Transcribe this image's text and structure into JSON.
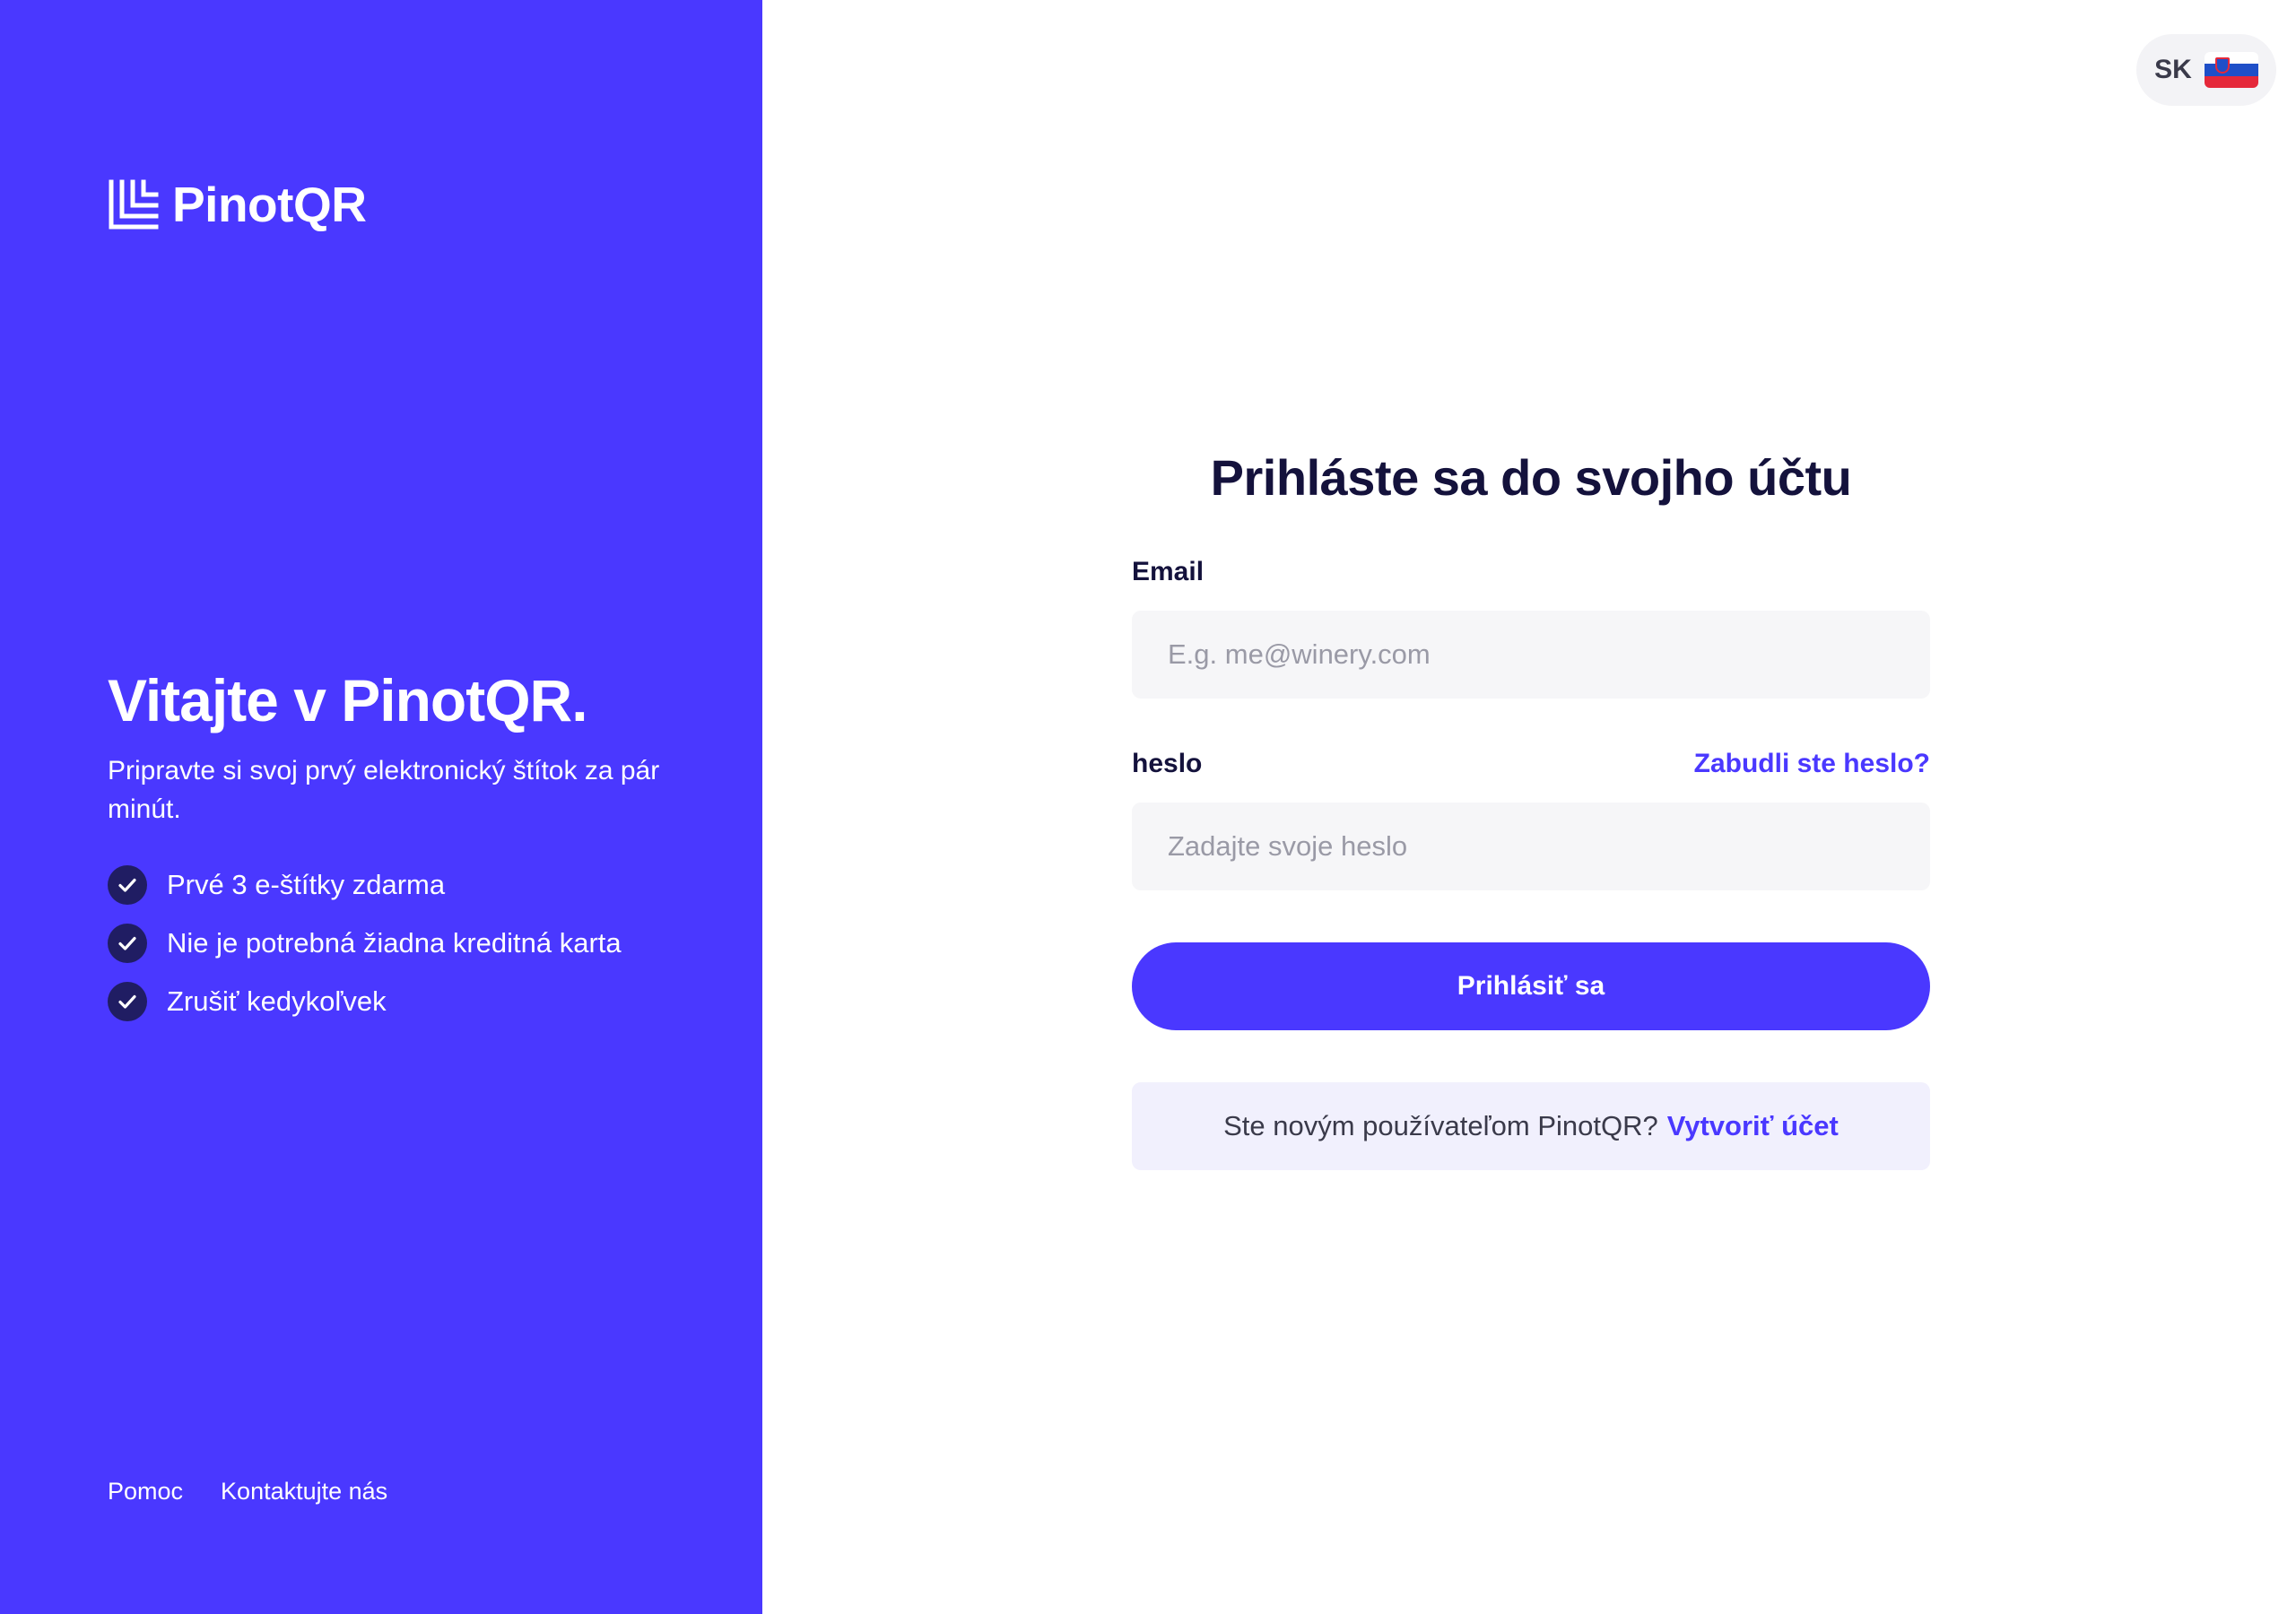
{
  "brand": {
    "name": "PinotQR",
    "accent_color": "#4a38ff",
    "dark_color": "#14123c"
  },
  "left_panel": {
    "welcome_title": "Vitajte v PinotQR.",
    "welcome_subtitle": "Pripravte si svoj prvý elektronický štítok za pár minút.",
    "features": [
      "Prvé 3 e-štítky zdarma",
      "Nie je potrebná žiadna kreditná karta",
      "Zrušiť kedykoľvek"
    ],
    "footer_links": [
      "Pomoc",
      "Kontaktujte nás"
    ]
  },
  "language_switcher": {
    "code": "SK",
    "flag_icon": "slovakia-flag-icon"
  },
  "login_form": {
    "title": "Prihláste sa do svojho účtu",
    "email_label": "Email",
    "email_placeholder": "E.g. me@winery.com",
    "email_value": "",
    "password_label": "heslo",
    "password_placeholder": "Zadajte svoje heslo",
    "password_value": "",
    "forgot_password_link": "Zabudli ste heslo?",
    "submit_label": "Prihlásiť sa",
    "signup_prompt": "Ste novým používateľom PinotQR?",
    "signup_link": "Vytvoriť účet"
  }
}
